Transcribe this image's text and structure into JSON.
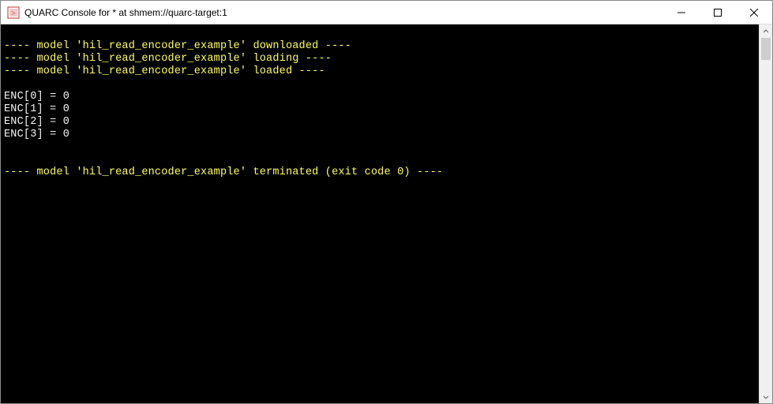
{
  "window": {
    "title": "QUARC Console for * at shmem://quarc-target:1"
  },
  "status_lines": {
    "downloaded": "---- model 'hil_read_encoder_example' downloaded ----",
    "loading": "---- model 'hil_read_encoder_example' loading ----",
    "loaded": "---- model 'hil_read_encoder_example' loaded ----",
    "terminated": "---- model 'hil_read_encoder_example' terminated (exit code 0) ----"
  },
  "encoder_outputs": {
    "l0": "ENC[0] = 0",
    "l1": "ENC[1] = 0",
    "l2": "ENC[2] = 0",
    "l3": "ENC[3] = 0"
  }
}
